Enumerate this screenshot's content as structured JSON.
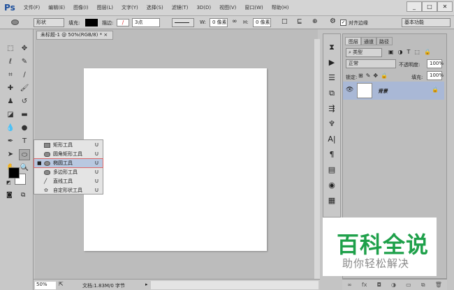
{
  "app": {
    "logo": "Ps"
  },
  "menu": [
    "文件(F)",
    "编辑(E)",
    "图像(I)",
    "图层(L)",
    "文字(Y)",
    "选择(S)",
    "滤镜(T)",
    "3D(D)",
    "视图(V)",
    "窗口(W)",
    "帮助(H)"
  ],
  "window": {
    "min": "_",
    "max": "□",
    "close": "✕"
  },
  "options": {
    "mode": "形状",
    "fill_label": "填充:",
    "stroke_label": "描边:",
    "stroke_size": "3点",
    "w_label": "W:",
    "w_value": "0 像素",
    "h_label": "H:",
    "h_value": "0 像素",
    "align_edges": "对齐边缘",
    "workspace": "基本功能"
  },
  "document": {
    "tab": "未标题-1 @ 50%(RGB/8) *",
    "close": "×"
  },
  "status": {
    "zoom": "50%",
    "doc_info": "文档:1.83M/0 字节"
  },
  "flyout": [
    {
      "label": "矩形工具",
      "shortcut": "U"
    },
    {
      "label": "圆角矩形工具",
      "shortcut": "U"
    },
    {
      "label": "椭圆工具",
      "shortcut": "U",
      "selected": true
    },
    {
      "label": "多边形工具",
      "shortcut": "U"
    },
    {
      "label": "直线工具",
      "shortcut": "U"
    },
    {
      "label": "自定形状工具",
      "shortcut": "U"
    }
  ],
  "panel": {
    "tabs": [
      "图层",
      "通道",
      "路径"
    ],
    "filter": "类型",
    "blend": "正常",
    "opacity_label": "不透明度:",
    "opacity": "100%",
    "lock_label": "锁定:",
    "fill_label": "填充:",
    "fill": "100%",
    "layer_name": "背景"
  },
  "watermark": {
    "title": "百科全说",
    "subtitle": "助你轻松解决"
  },
  "colors": {
    "accent": "#1ea04a",
    "selection": "#a9b8d6"
  }
}
